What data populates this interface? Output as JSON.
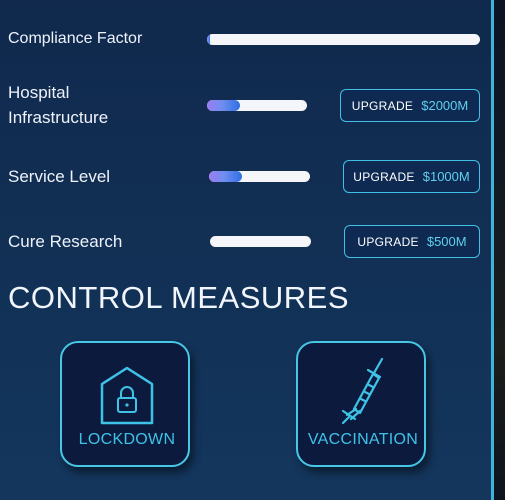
{
  "stats": [
    {
      "label": "Compliance Factor",
      "progress": 0.01
    },
    {
      "label": "Hospital Infrastructure",
      "progress": 0.33,
      "upgrade_label": "UPGRADE",
      "price": "$2000M"
    },
    {
      "label": "Service Level",
      "progress": 0.33,
      "upgrade_label": "UPGRADE",
      "price": "$1000M"
    },
    {
      "label": "Cure Research",
      "progress": 0.0,
      "upgrade_label": "UPGRADE",
      "price": "$500M"
    }
  ],
  "control_measures": {
    "title": "CONTROL MEASURES",
    "buttons": [
      {
        "label": "LOCKDOWN",
        "icon": "lock-house-icon"
      },
      {
        "label": "VACCINATION",
        "icon": "syringe-icon"
      }
    ]
  },
  "colors": {
    "background": "#10294d",
    "accent": "#3fc0e4",
    "bar_fill_start": "#9c7cf2",
    "bar_fill_end": "#2f6fe3"
  }
}
